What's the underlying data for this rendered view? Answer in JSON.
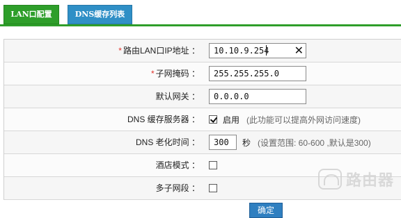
{
  "tabs": [
    {
      "label": "LAN口配置",
      "active": true,
      "color": "#2e9e2a"
    },
    {
      "label": "DNS缓存列表",
      "active": false,
      "color": "#2f8fc6"
    }
  ],
  "form": {
    "lan_ip": {
      "label": "路由LAN口IP地址 ：",
      "required_mark": "*",
      "value": "10.10.9.254"
    },
    "subnet": {
      "label": "子网掩码 ：",
      "required_mark": "*",
      "value": "255.255.255.0"
    },
    "gateway": {
      "label": "默认网关 ：",
      "value": "0.0.0.0"
    },
    "dns_cache": {
      "label": "DNS 缓存服务器 ：",
      "checked": true,
      "option_label": "启用",
      "hint": "(此功能可以提高外网访问速度)"
    },
    "dns_aging": {
      "label": "DNS 老化时间 ：",
      "value": "300",
      "unit": "秒",
      "hint": "(设置范围: 60-600 ,默认是300)"
    },
    "hotel_mode": {
      "label": "酒店模式 ：",
      "checked": false
    },
    "multi_subnet": {
      "label": "多子网段 ：",
      "checked": false
    }
  },
  "confirm_label": "确定",
  "watermark": {
    "text": "路由器"
  },
  "colors": {
    "accent_green": "#2e9e2a",
    "accent_blue": "#2f8fc6",
    "required": "#e0312a"
  }
}
